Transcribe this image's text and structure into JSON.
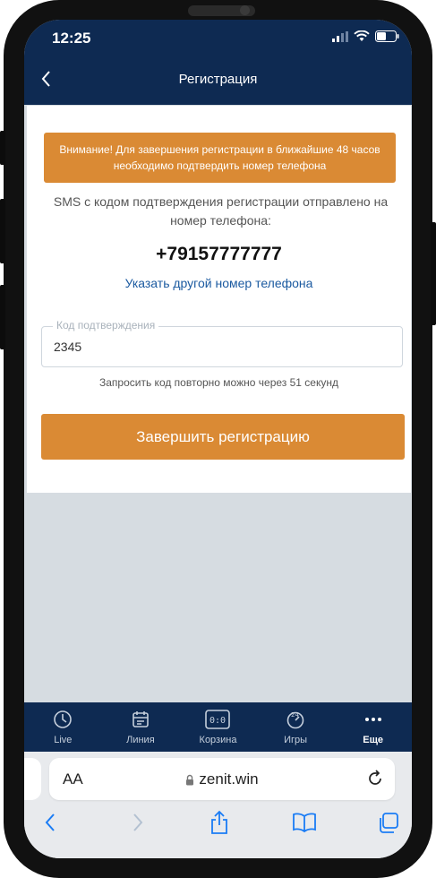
{
  "status_bar": {
    "time": "12:25"
  },
  "nav": {
    "title": "Регистрация"
  },
  "alert": {
    "text": "Внимание! Для завершения регистрации в ближайшие 48 часов необходимо подтвердить номер телефона"
  },
  "sms_info": "SMS с кодом подтверждения регистрации отправлено на номер телефона:",
  "phone_number": "+79157777777",
  "change_number_link": "Указать другой номер телефона",
  "code_field": {
    "label": "Код подтверждения",
    "value": "2345"
  },
  "resend_info": "Запросить код повторно можно через 51 секунд",
  "submit_label": "Завершить регистрацию",
  "tabs": [
    {
      "label": "Live",
      "icon": "clock-icon"
    },
    {
      "label": "Линия",
      "icon": "calendar-icon"
    },
    {
      "label": "Корзина",
      "icon": "scoreboard-icon"
    },
    {
      "label": "Игры",
      "icon": "24-7-icon"
    },
    {
      "label": "Еще",
      "icon": "more-icon"
    }
  ],
  "browser": {
    "text_size_label": "AA",
    "domain": "zenit.win"
  },
  "colors": {
    "navy": "#0e2a52",
    "accent": "#da8a34",
    "link": "#1b5aa0",
    "safari_blue": "#1a7cf5"
  }
}
